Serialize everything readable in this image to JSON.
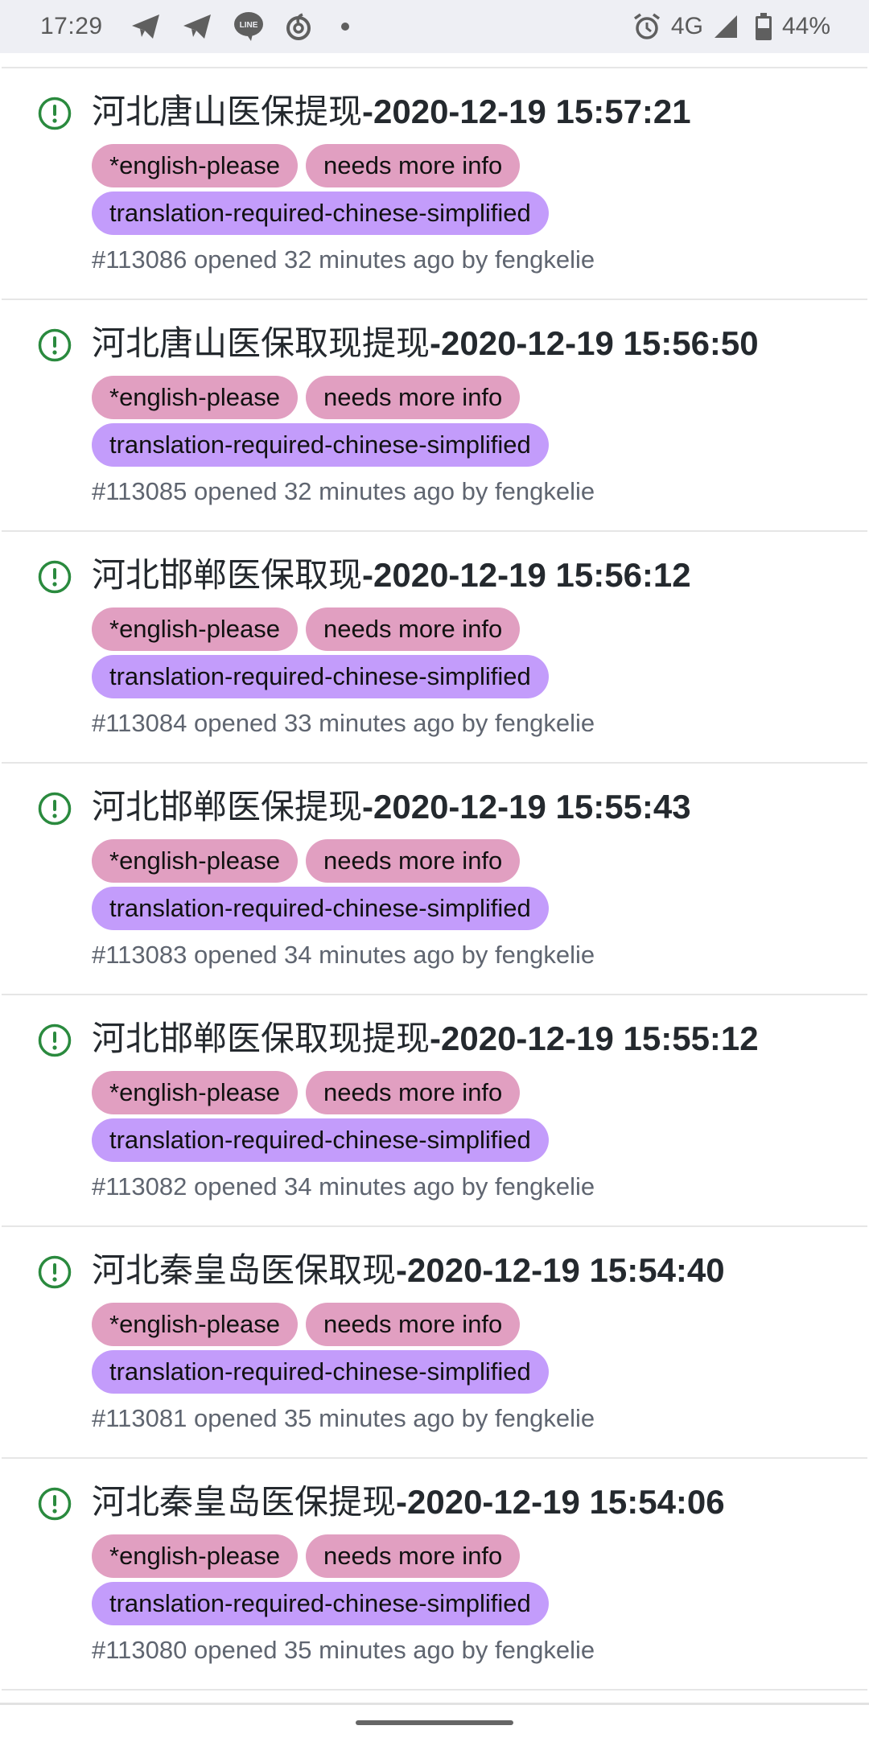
{
  "status_bar": {
    "time": "17:29",
    "notification_icons": [
      "telegram-icon",
      "telegram-icon",
      "line-icon",
      "netease-music-icon",
      "more-notifications-dot"
    ],
    "network": "4G",
    "battery": "44%"
  },
  "colors": {
    "open_issue_icon": "#2a8a3e",
    "label_english_please": "#e19fc1",
    "label_needs_more_info": "#e19fc1",
    "label_translation_required": "#c39cfb"
  },
  "issues": [
    {
      "title_cn": "河北唐山医保提现",
      "title_ts": "-2020-12-19 15:57:21",
      "labels": [
        "*english-please",
        "needs more info",
        "translation-required-chinese-simplified"
      ],
      "meta": "#113086 opened 32 minutes ago by fengkelie"
    },
    {
      "title_cn": "河北唐山医保取现提现",
      "title_ts": "-2020-12-19 15:56:50",
      "labels": [
        "*english-please",
        "needs more info",
        "translation-required-chinese-simplified"
      ],
      "meta": "#113085 opened 32 minutes ago by fengkelie"
    },
    {
      "title_cn": "河北邯郸医保取现",
      "title_ts": "-2020-12-19 15:56:12",
      "labels": [
        "*english-please",
        "needs more info",
        "translation-required-chinese-simplified"
      ],
      "meta": "#113084 opened 33 minutes ago by fengkelie"
    },
    {
      "title_cn": "河北邯郸医保提现",
      "title_ts": "-2020-12-19 15:55:43",
      "labels": [
        "*english-please",
        "needs more info",
        "translation-required-chinese-simplified"
      ],
      "meta": "#113083 opened 34 minutes ago by fengkelie"
    },
    {
      "title_cn": "河北邯郸医保取现提现",
      "title_ts": "-2020-12-19 15:55:12",
      "labels": [
        "*english-please",
        "needs more info",
        "translation-required-chinese-simplified"
      ],
      "meta": "#113082 opened 34 minutes ago by fengkelie"
    },
    {
      "title_cn": "河北秦皇岛医保取现",
      "title_ts": "-2020-12-19 15:54:40",
      "labels": [
        "*english-please",
        "needs more info",
        "translation-required-chinese-simplified"
      ],
      "meta": "#113081 opened 35 minutes ago by fengkelie"
    },
    {
      "title_cn": "河北秦皇岛医保提现",
      "title_ts": "-2020-12-19 15:54:06",
      "labels": [
        "*english-please",
        "needs more info",
        "translation-required-chinese-simplified"
      ],
      "meta": "#113080 opened 35 minutes ago by fengkelie"
    }
  ]
}
